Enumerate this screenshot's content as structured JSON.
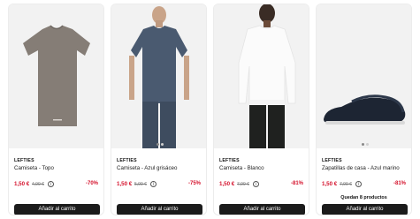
{
  "products": [
    {
      "brand": "LEFTIES",
      "name": "Camiseta - Topo",
      "price": "1,50 €",
      "old_price": "4,99 €",
      "discount": "-70%",
      "stock_note": "",
      "add_label": "Añadir al carrito",
      "image": "taupe-tshirt"
    },
    {
      "brand": "LEFTIES",
      "name": "Camiseta - Azul grisáceo",
      "price": "1,50 €",
      "old_price": "5,99 €",
      "discount": "-75%",
      "stock_note": "",
      "add_label": "Añadir al carrito",
      "image": "model-blue-grey-tshirt"
    },
    {
      "brand": "LEFTIES",
      "name": "Camiseta - Blanco",
      "price": "1,50 €",
      "old_price": "7,99 €",
      "discount": "-81%",
      "stock_note": "",
      "add_label": "Añadir al carrito",
      "image": "model-white-longsleeve"
    },
    {
      "brand": "LEFTIES",
      "name": "Zapatillas de casa - Azul marino",
      "price": "1,50 €",
      "old_price": "7,99 €",
      "discount": "-81%",
      "stock_note": "Quedan 8 productos",
      "add_label": "Añadir al carrito",
      "image": "navy-slipper"
    }
  ],
  "info_glyph": "i",
  "colors": {
    "sale_red": "#d4112b",
    "button_bg": "#1b1b1b",
    "card_border": "#ececec"
  }
}
